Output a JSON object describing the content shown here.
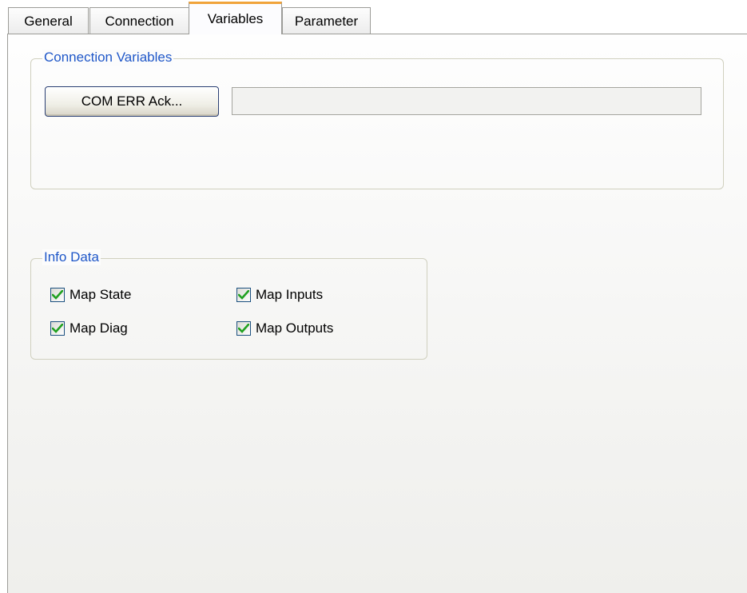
{
  "tabs": [
    {
      "label": "General",
      "active": false
    },
    {
      "label": "Connection",
      "active": false
    },
    {
      "label": "Variables",
      "active": true
    },
    {
      "label": "Parameter",
      "active": false
    }
  ],
  "connection_variables": {
    "title": "Connection Variables",
    "button_label": "COM ERR Ack...",
    "field_value": ""
  },
  "info_data": {
    "title": "Info Data",
    "checkboxes": [
      {
        "label": "Map State",
        "checked": true
      },
      {
        "label": "Map Inputs",
        "checked": true
      },
      {
        "label": "Map Diag",
        "checked": true
      },
      {
        "label": "Map Outputs",
        "checked": true
      }
    ]
  },
  "colors": {
    "accent": "#f0a33a",
    "group_title": "#1f57c8",
    "checkmark": "#21a121"
  }
}
